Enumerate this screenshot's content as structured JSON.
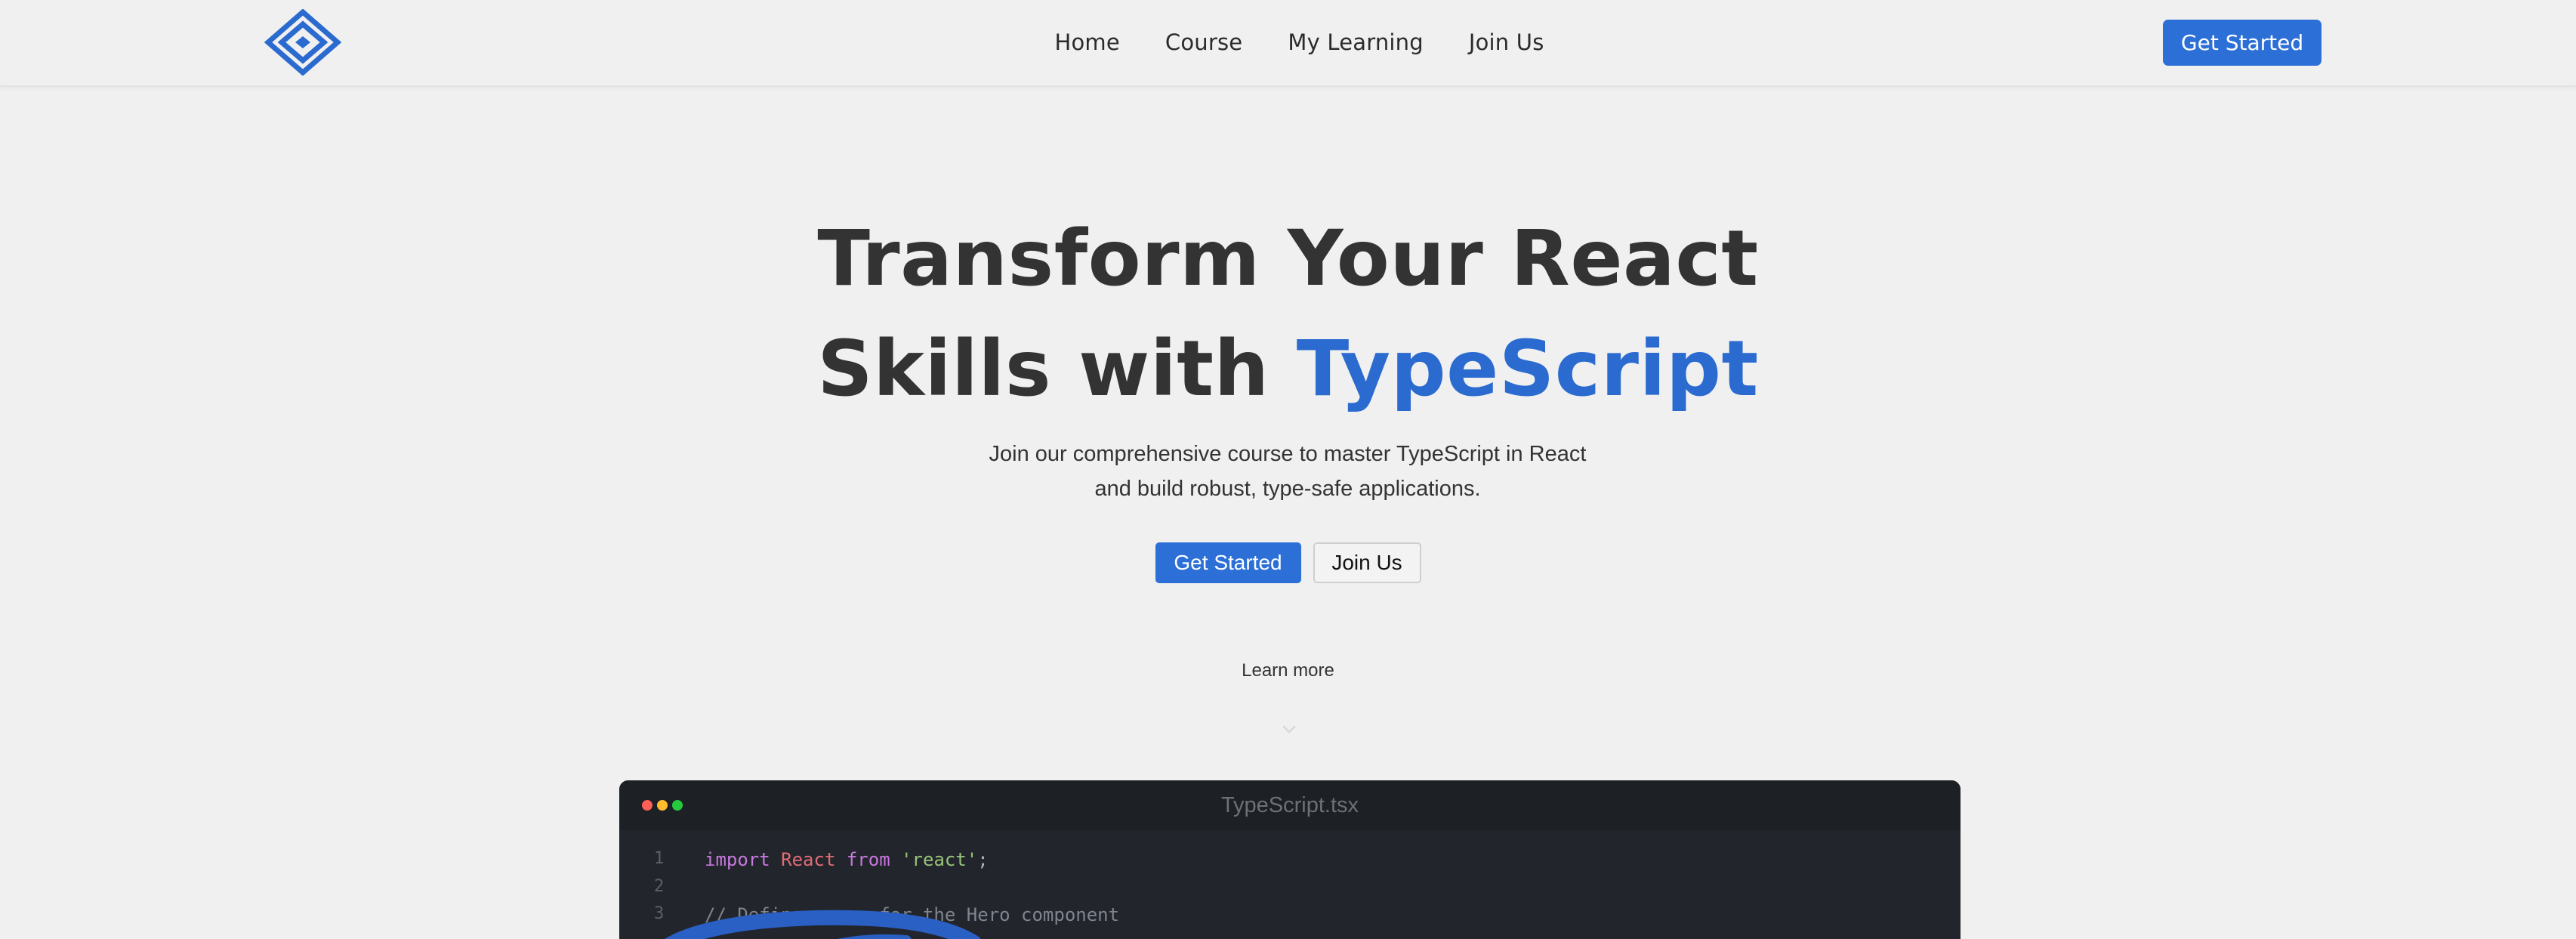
{
  "navbar": {
    "links": [
      "Home",
      "Course",
      "My Learning",
      "Join Us"
    ],
    "cta_label": "Get Started"
  },
  "hero": {
    "title_line1": "Transform Your React",
    "title_line2_prefix": "Skills with ",
    "title_line2_accent": "TypeScript",
    "subtitle": "Join our comprehensive course to master TypeScript in React and build robust, type-safe applications.",
    "primary_button": "Get Started",
    "secondary_button": "Join Us",
    "learn_more": "Learn more"
  },
  "code_window": {
    "filename": "TypeScript.tsx",
    "lines": [
      {
        "n": "1",
        "kw1": "import",
        "id": "React",
        "kw2": "from",
        "str": "'react'",
        "end": ";"
      },
      {
        "n": "2"
      },
      {
        "n": "3",
        "comment": "// Define props for the Hero component"
      }
    ]
  },
  "colors": {
    "accent": "#2c6fd6",
    "background": "#f0f0f0",
    "text": "#333333",
    "code_bg": "#22262c"
  },
  "icons": [
    "logo-diamond-icon",
    "chevron-down-icon",
    "window-controls-icon"
  ]
}
